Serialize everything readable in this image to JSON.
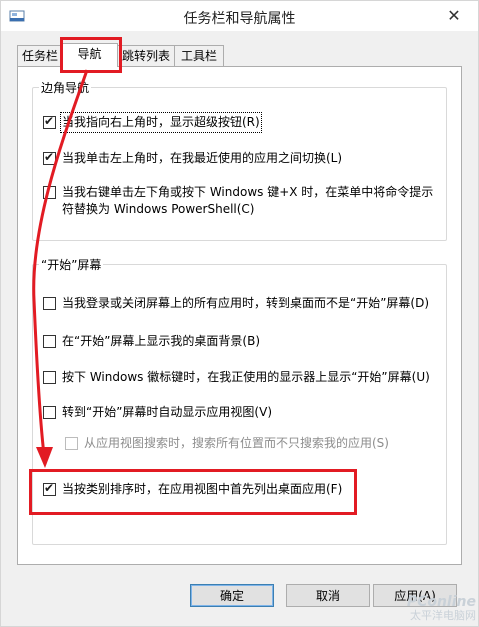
{
  "window": {
    "title": "任务栏和导航属性"
  },
  "tabs": [
    {
      "label": "任务栏",
      "active": false
    },
    {
      "label": "导航",
      "active": true
    },
    {
      "label": "跳转列表",
      "active": false
    },
    {
      "label": "工具栏",
      "active": false
    }
  ],
  "corner_nav": {
    "legend": "边角导航",
    "options": [
      {
        "label": "当我指向右上角时，显示超级按钮(R)",
        "checked": true
      },
      {
        "label": "当我单击左上角时，在我最近使用的应用之间切换(L)",
        "checked": true
      },
      {
        "label": "当我右键单击左下角或按下 Windows 键+X 时，在菜单中将命令提示符替换为 Windows PowerShell(C)",
        "checked": false
      }
    ]
  },
  "start_screen": {
    "legend": "“开始”屏幕",
    "options": [
      {
        "label": "当我登录或关闭屏幕上的所有应用时，转到桌面而不是“开始”屏幕(D)",
        "checked": false
      },
      {
        "label": "在“开始”屏幕上显示我的桌面背景(B)",
        "checked": false
      },
      {
        "label": "按下 Windows 徽标键时，在我正使用的显示器上显示“开始”屏幕(U)",
        "checked": false
      },
      {
        "label": "转到“开始”屏幕时自动显示应用视图(V)",
        "checked": false
      },
      {
        "label": "从应用视图搜索时，搜索所有位置而不只搜索我的应用(S)",
        "checked": false,
        "disabled": true
      },
      {
        "label": "当按类别排序时，在应用视图中首先列出桌面应用(F)",
        "checked": true
      }
    ]
  },
  "buttons": {
    "ok": "确定",
    "cancel": "取消",
    "apply": "应用(A)"
  },
  "watermark": {
    "line1": "PConline",
    "line2": "太平洋电脑网"
  },
  "colors": {
    "annotation_red": "#e21b23",
    "accent_blue": "#3c7fb1"
  }
}
